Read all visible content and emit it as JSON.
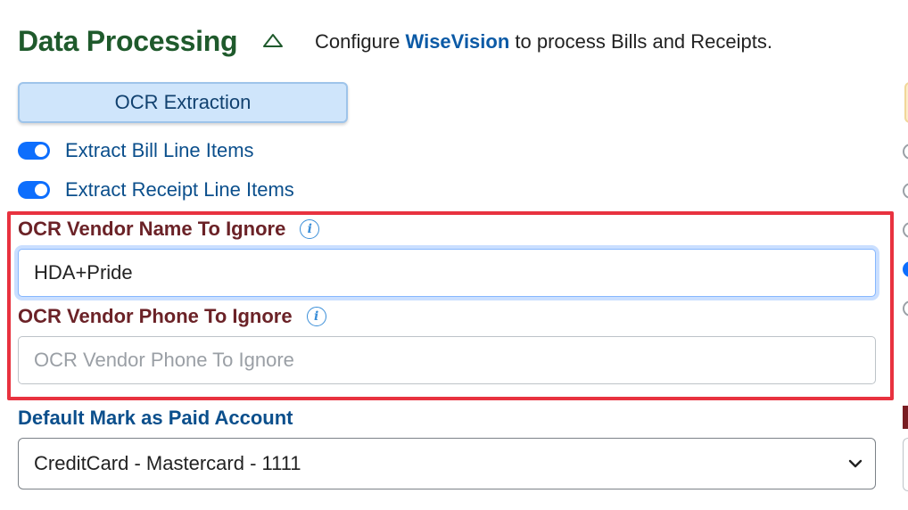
{
  "header": {
    "title": "Data Processing",
    "subtitle_prefix": "Configure ",
    "brand": "WiseVision",
    "subtitle_suffix": " to process Bills and Receipts."
  },
  "tabs": {
    "ocr_extraction": "OCR Extraction"
  },
  "toggles": [
    {
      "label": "Extract Bill Line Items",
      "checked": true
    },
    {
      "label": "Extract Receipt Line Items",
      "checked": true
    }
  ],
  "fields": {
    "vendor_name": {
      "label": "OCR Vendor Name To Ignore",
      "value": "HDA+Pride",
      "placeholder": ""
    },
    "vendor_phone": {
      "label": "OCR Vendor Phone To Ignore",
      "value": "",
      "placeholder": "OCR Vendor Phone To Ignore"
    }
  },
  "paid_account": {
    "label": "Default Mark as Paid Account",
    "selected": "CreditCard - Mastercard - 1111"
  },
  "icons": {
    "collapse": "chevron-up-outline-icon",
    "info": "info-circle-icon",
    "select": "chevron-down-icon"
  },
  "colors": {
    "title": "#1f5a2c",
    "brand": "#0b5aa6",
    "toggle_on": "#0d6efd",
    "field_label": "#6b2227",
    "highlight": "#e8323f"
  }
}
